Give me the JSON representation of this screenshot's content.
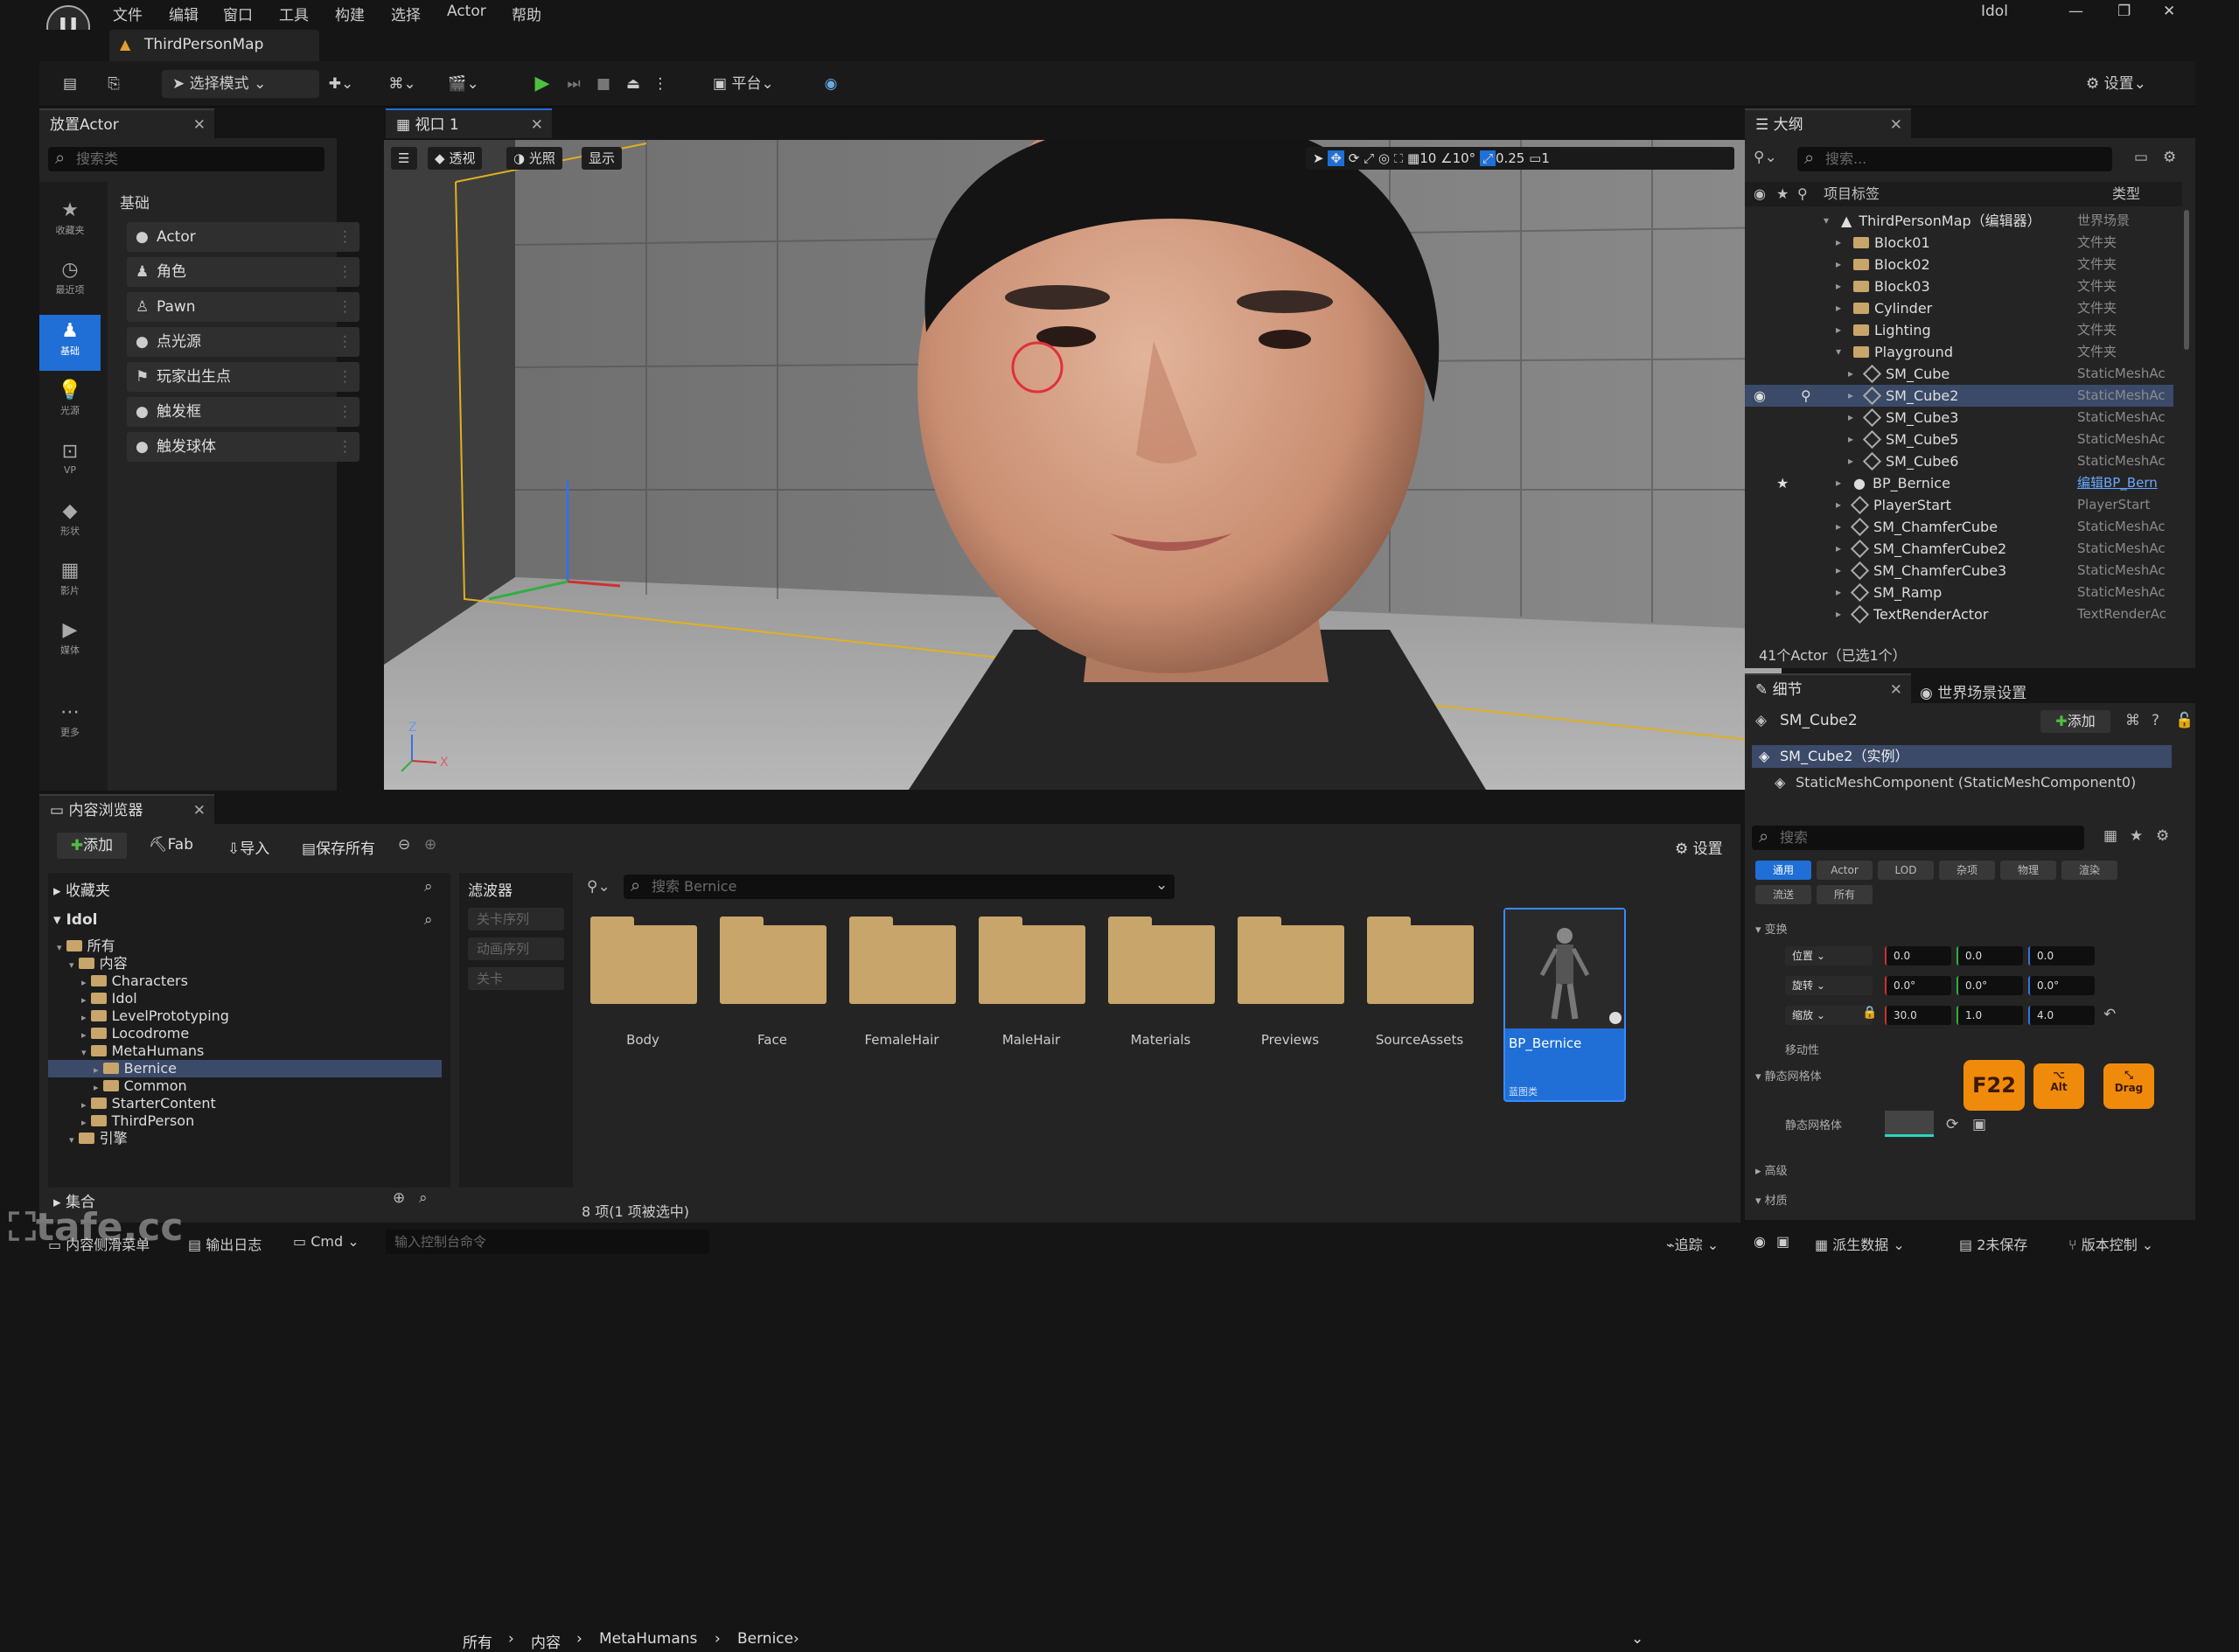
{
  "app": {
    "user": "Idol",
    "map_tab": "ThirdPersonMap"
  },
  "menu": [
    "文件",
    "编辑",
    "窗口",
    "工具",
    "构建",
    "选择",
    "Actor",
    "帮助"
  ],
  "toolbar": {
    "mode": "选择模式",
    "platform": "平台",
    "settings": "设置"
  },
  "place_actor": {
    "title": "放置Actor",
    "search_placeholder": "搜索类",
    "category": "基础",
    "sidebar": [
      "收藏夹",
      "最近项",
      "基础",
      "光源",
      "VP",
      "形状",
      "影片",
      "媒体",
      "更多"
    ],
    "items": [
      "Actor",
      "角色",
      "Pawn",
      "点光源",
      "玩家出生点",
      "触发框",
      "触发球体"
    ]
  },
  "viewport": {
    "tab": "视口 1",
    "perspective": "透视",
    "lit": "光照",
    "show": "显示",
    "grid": "10",
    "angle": "10°",
    "scale": "0.25",
    "camera_speed": "1"
  },
  "outliner": {
    "title": "大纲",
    "search_placeholder": "搜索...",
    "col_label": "项目标签",
    "col_type": "类型",
    "rows": [
      {
        "name": "ThirdPersonMap（编辑器）",
        "type": "世界场景",
        "indent": 0,
        "kind": "map"
      },
      {
        "name": "Block01",
        "type": "文件夹",
        "indent": 1,
        "kind": "folder"
      },
      {
        "name": "Block02",
        "type": "文件夹",
        "indent": 1,
        "kind": "folder"
      },
      {
        "name": "Block03",
        "type": "文件夹",
        "indent": 1,
        "kind": "folder"
      },
      {
        "name": "Cylinder",
        "type": "文件夹",
        "indent": 1,
        "kind": "folder"
      },
      {
        "name": "Lighting",
        "type": "文件夹",
        "indent": 1,
        "kind": "folder"
      },
      {
        "name": "Playground",
        "type": "文件夹",
        "indent": 1,
        "kind": "folder"
      },
      {
        "name": "SM_Cube",
        "type": "StaticMeshAc",
        "indent": 2,
        "kind": "mesh"
      },
      {
        "name": "SM_Cube2",
        "type": "StaticMeshAc",
        "indent": 2,
        "kind": "mesh",
        "selected": true
      },
      {
        "name": "SM_Cube3",
        "type": "StaticMeshAc",
        "indent": 2,
        "kind": "mesh"
      },
      {
        "name": "SM_Cube5",
        "type": "StaticMeshAc",
        "indent": 2,
        "kind": "mesh"
      },
      {
        "name": "SM_Cube6",
        "type": "StaticMeshAc",
        "indent": 2,
        "kind": "mesh"
      },
      {
        "name": "BP_Bernice",
        "type": "编辑BP_Bern",
        "indent": 1,
        "kind": "bp"
      },
      {
        "name": "PlayerStart",
        "type": "PlayerStart",
        "indent": 1,
        "kind": "mesh"
      },
      {
        "name": "SM_ChamferCube",
        "type": "StaticMeshAc",
        "indent": 1,
        "kind": "mesh"
      },
      {
        "name": "SM_ChamferCube2",
        "type": "StaticMeshAc",
        "indent": 1,
        "kind": "mesh"
      },
      {
        "name": "SM_ChamferCube3",
        "type": "StaticMeshAc",
        "indent": 1,
        "kind": "mesh"
      },
      {
        "name": "SM_Ramp",
        "type": "StaticMeshAc",
        "indent": 1,
        "kind": "mesh"
      },
      {
        "name": "TextRenderActor",
        "type": "TextRenderAc",
        "indent": 1,
        "kind": "mesh"
      }
    ],
    "footer": "41个Actor（已选1个）"
  },
  "details": {
    "tab": "细节",
    "tab2": "世界场景设置",
    "object": "SM_Cube2",
    "add": "添加",
    "instance": "SM_Cube2（实例）",
    "component": "StaticMeshComponent (StaticMeshComponent0)",
    "search_placeholder": "搜索",
    "filters": [
      "通用",
      "Actor",
      "LOD",
      "杂项",
      "物理",
      "渲染",
      "流送",
      "所有"
    ],
    "transform": "变换",
    "location_label": "位置",
    "rotation_label": "旋转",
    "scale_label": "缩放",
    "location": [
      "0.0",
      "0.0",
      "0.0"
    ],
    "rotation": [
      "0.0°",
      "0.0°",
      "0.0°"
    ],
    "scale": [
      "30.0",
      "1.0",
      "4.0"
    ],
    "mobility": "移动性",
    "static_mesh_section": "静态网格体",
    "static_mesh_label": "静态网格体",
    "advanced": "高级",
    "materials": "材质"
  },
  "keys": {
    "k1": "F22",
    "k2": "Alt",
    "k3": "Drag"
  },
  "content_browser": {
    "title": "内容浏览器",
    "add": "添加",
    "fab": "Fab",
    "import": "导入",
    "save_all": "保存所有",
    "settings": "设置",
    "breadcrumb": [
      "所有",
      "内容",
      "MetaHumans",
      "Bernice"
    ],
    "favorites": "收藏夹",
    "project": "Idol",
    "tree": [
      {
        "label": "所有",
        "level": 0
      },
      {
        "label": "内容",
        "level": 1
      },
      {
        "label": "Characters",
        "level": 2
      },
      {
        "label": "Idol",
        "level": 2
      },
      {
        "label": "LevelPrototyping",
        "level": 2
      },
      {
        "label": "Locodrome",
        "level": 2
      },
      {
        "label": "MetaHumans",
        "level": 2
      },
      {
        "label": "Bernice",
        "level": 3,
        "selected": true
      },
      {
        "label": "Common",
        "level": 3
      },
      {
        "label": "StarterContent",
        "level": 2
      },
      {
        "label": "ThirdPerson",
        "level": 2
      },
      {
        "label": "引擎",
        "level": 1
      }
    ],
    "collections": "集合",
    "filters_title": "滤波器",
    "filter_items": [
      "关卡序列",
      "动画序列",
      "关卡"
    ],
    "search_placeholder": "搜索 Bernice",
    "assets": [
      "Body",
      "Face",
      "FemaleHair",
      "MaleHair",
      "Materials",
      "Previews",
      "SourceAssets"
    ],
    "bp_asset": {
      "name": "BP_Bernice",
      "type": "蓝图类"
    },
    "count": "8 项(1 项被选中)"
  },
  "statusbar": {
    "drawer": "内容侧滑菜单",
    "log": "输出日志",
    "cmd": "Cmd",
    "cmd_placeholder": "输入控制台命令",
    "trace": "追踪",
    "derived": "派生数据",
    "unsaved": "2未保存",
    "source_control": "版本控制"
  },
  "watermark": "tafe.cc"
}
